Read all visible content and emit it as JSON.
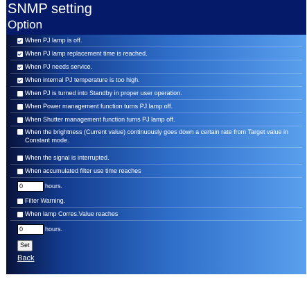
{
  "header": {
    "title": "SNMP setting",
    "subtitle": "Option"
  },
  "options": [
    {
      "label": "When PJ lamp is off.",
      "checked": true
    },
    {
      "label": "When PJ lamp replacement time is reached.",
      "checked": true
    },
    {
      "label": "When PJ needs service.",
      "checked": true
    },
    {
      "label": "When internal PJ temperature is too high.",
      "checked": true
    },
    {
      "label": "When PJ is turned into Standby in proper user operation.",
      "checked": false
    },
    {
      "label": "When Power management function turns PJ lamp off.",
      "checked": false
    },
    {
      "label": "When Shutter management function turns PJ lamp off.",
      "checked": false
    },
    {
      "label": "When the brightness (Current value) continuously goes down a certain rate from Target value in Constant mode.",
      "checked": false
    },
    {
      "label": "When the signal is interrupted.",
      "checked": false
    },
    {
      "label": "When accumulated filter use time reaches",
      "checked": false
    }
  ],
  "filter_hours": {
    "value": "0",
    "unit": "hours."
  },
  "filter_warning": {
    "label": "Filter Warning.",
    "checked": false
  },
  "lamp_corres": {
    "label": "When lamp Corres.Value reaches",
    "checked": false
  },
  "lamp_hours": {
    "value": "0",
    "unit": "hours."
  },
  "set_button": "Set",
  "back_link": "Back"
}
